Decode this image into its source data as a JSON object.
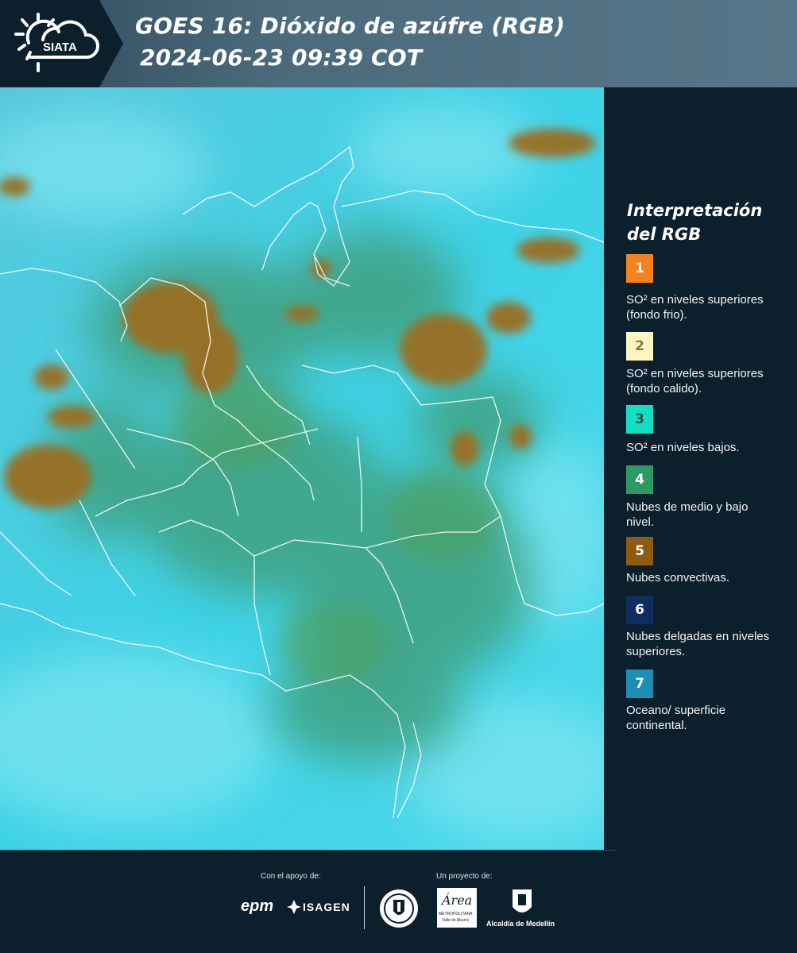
{
  "header": {
    "logo_text": "SIATA",
    "title_line1": "GOES 16: Dióxido de azúfre (RGB)",
    "title_line2": "2024-06-23 09:39 COT"
  },
  "legend": {
    "title": "Interpretación del RGB",
    "items": [
      {
        "number": "1",
        "color": "#f5821f",
        "num_color": "#ffffff",
        "label": "SO² en niveles superiores (fondo frio)."
      },
      {
        "number": "2",
        "color": "#fdf6c3",
        "num_color": "#8a7a3a",
        "label": "SO² en niveles superiores (fondo calido)."
      },
      {
        "number": "3",
        "color": "#12e0c4",
        "num_color": "#2d4e4a",
        "label": "SO² en niveles bajos."
      },
      {
        "number": "4",
        "color": "#2f9966",
        "num_color": "#ffffff",
        "label": "Nubes de medio y bajo nivel."
      },
      {
        "number": "5",
        "color": "#8f5a12",
        "num_color": "#ffffff",
        "label": "Nubes convectivas."
      },
      {
        "number": "6",
        "color": "#0f2e5e",
        "num_color": "#ffffff",
        "label": "Nubes delgadas en niveles superiores."
      },
      {
        "number": "7",
        "color": "#1c8db5",
        "num_color": "#ffffff",
        "label": "Oceano/ superficie continental."
      }
    ]
  },
  "footer": {
    "support_label": "Con el apoyo de:",
    "project_label": "Un proyecto de:",
    "sponsor_epm": "epm",
    "sponsor_isagen": "ISAGEN",
    "partner_area_name": "Área",
    "partner_area_sub1": "METROPOLITANA",
    "partner_area_sub2": "Valle de Aburrá",
    "partner_alcaldia": "Alcaldía de Medellín"
  }
}
